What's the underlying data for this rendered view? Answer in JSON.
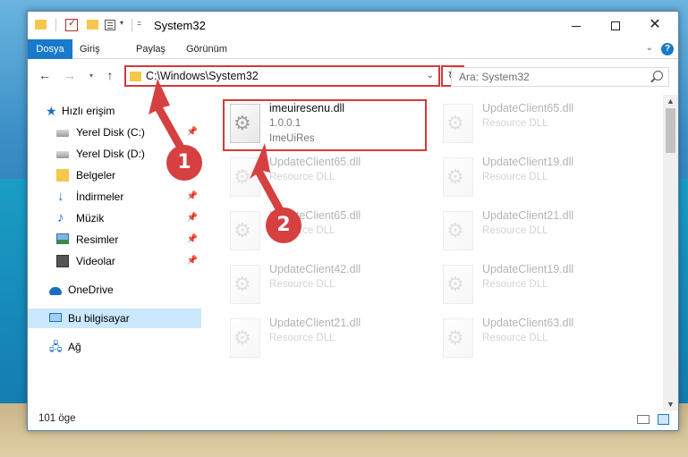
{
  "window": {
    "title": "System32"
  },
  "ribbon": {
    "tabs": [
      "Dosya",
      "Giriş",
      "Paylaş",
      "Görünüm"
    ],
    "help": "?"
  },
  "navbar": {
    "address": "C:\\Windows\\System32",
    "search_placeholder": "Ara: System32"
  },
  "sidebar": {
    "items": [
      {
        "label": "Hızlı erişim",
        "icon": "star-icon"
      },
      {
        "label": "Yerel Disk (C:)",
        "icon": "disk-icon"
      },
      {
        "label": "Yerel Disk (D:)",
        "icon": "disk-icon"
      },
      {
        "label": "Belgeler",
        "icon": "documents-icon"
      },
      {
        "label": "İndirmeler",
        "icon": "download-icon"
      },
      {
        "label": "Müzik",
        "icon": "music-icon"
      },
      {
        "label": "Resimler",
        "icon": "pictures-icon"
      },
      {
        "label": "Videolar",
        "icon": "videos-icon"
      },
      {
        "label": "OneDrive",
        "icon": "cloud-icon"
      },
      {
        "label": "Bu bilgisayar",
        "icon": "computer-icon"
      },
      {
        "label": "Ağ",
        "icon": "network-icon"
      }
    ]
  },
  "files": {
    "highlighted": {
      "name": "imeuiresenu.dll",
      "version": "1.0.0.1",
      "description": "ImeUiRes"
    },
    "left": [
      {
        "name": "UpdateClient65.dll",
        "type": "Resource DLL"
      },
      {
        "name": "UpdateClient65.dll",
        "type": "Resource DLL"
      },
      {
        "name": "UpdateClient42.dll",
        "type": "Resource DLL"
      },
      {
        "name": "UpdateClient21.dll",
        "type": "Resource DLL"
      }
    ],
    "right": [
      {
        "name": "UpdateClient65.dll",
        "type": "Resource DLL"
      },
      {
        "name": "UpdateClient19.dll",
        "type": "Resource DLL"
      },
      {
        "name": "UpdateClient21.dll",
        "type": "Resource DLL"
      },
      {
        "name": "UpdateClient19.dll",
        "type": "Resource DLL"
      },
      {
        "name": "UpdateClient63.dll",
        "type": "Resource DLL"
      }
    ]
  },
  "status": {
    "count": "101 öge"
  },
  "callouts": [
    "1",
    "2"
  ],
  "colors": {
    "accent": "#1979ca",
    "highlight": "#d43a3a",
    "callout": "#d64040"
  }
}
